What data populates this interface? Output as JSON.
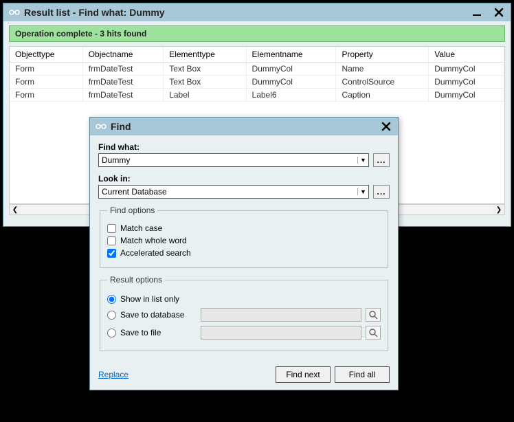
{
  "mainWindow": {
    "title": "Result list - Find what: Dummy",
    "status": "Operation complete - 3 hits found",
    "columns": [
      "Objecttype",
      "Objectname",
      "Elementtype",
      "Elementname",
      "Property",
      "Value"
    ],
    "rows": [
      {
        "c0": "Form",
        "c1": "frmDateTest",
        "c2": "Text Box",
        "c3": "DummyCol",
        "c4": "Name",
        "c5": "DummyCol"
      },
      {
        "c0": "Form",
        "c1": "frmDateTest",
        "c2": "Text Box",
        "c3": "DummyCol",
        "c4": "ControlSource",
        "c5": "DummyCol"
      },
      {
        "c0": "Form",
        "c1": "frmDateTest",
        "c2": "Label",
        "c3": "Label6",
        "c4": "Caption",
        "c5": "DummyCol"
      }
    ]
  },
  "findDialog": {
    "title": "Find",
    "findWhatLabel": "Find what:",
    "findWhatValue": "Dummy",
    "lookInLabel": "Look in:",
    "lookInValue": "Current Database",
    "findOptionsLegend": "Find options",
    "matchCase": "Match case",
    "matchWholeWord": "Match whole word",
    "acceleratedSearch": "Accelerated search",
    "resultOptionsLegend": "Result options",
    "showInListOnly": "Show in list only",
    "saveToDatabase": "Save to database",
    "saveToFile": "Save to file",
    "replaceLink": "Replace",
    "findNext": "Find next",
    "findAll": "Find all",
    "ellipsis": "..."
  }
}
